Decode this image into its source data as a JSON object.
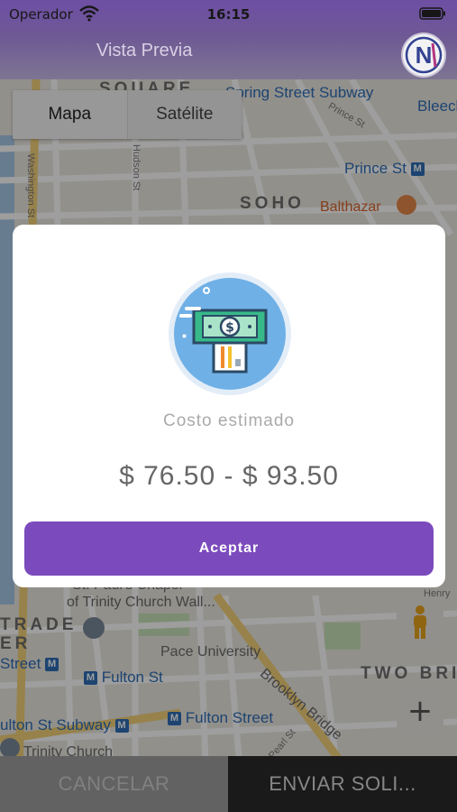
{
  "status_bar": {
    "carrier": "Operador",
    "time": "16:15",
    "wifi_icon": "wifi-icon",
    "battery_icon": "battery-icon"
  },
  "header": {
    "title": "Vista Previa",
    "logo_letter": "N",
    "background_color": "#6b4fa0"
  },
  "map_type": {
    "map_label": "Mapa",
    "satellite_label": "Satélite",
    "selected": "Mapa"
  },
  "map_labels": {
    "square": "SQUARE",
    "spring_street_subway": "Spring Street Subway",
    "prince_st_top": "Prince St",
    "bleecker": "Bleeck",
    "prince_st": "Prince St",
    "soho": "SOHO",
    "balthazar": "Balthazar",
    "washington_st": "Washington St",
    "hudson_st": "Hudson St",
    "st_pauls": "St. Paul's Chapel",
    "trinity_wall": "of Trinity Church Wall...",
    "trade": "TRADE",
    "er": "ER",
    "street": "Street",
    "pace": "Pace University",
    "fulton_st": "Fulton St",
    "fulton_subway": "ulton St Subway",
    "fulton_street": "Fulton Street",
    "two_bri": "TWO BRI",
    "brooklyn_bridge": "Brooklyn Bridge",
    "pearl_st": "Pearl St",
    "trinity_church": "Trinity Church",
    "henry": "Henry",
    "metro_symbol": "M"
  },
  "modal": {
    "cost_label": "Costo estimado",
    "cost_range": "$ 76.50 - $ 93.50",
    "accept_label": "Aceptar",
    "dollar_symbol": "$",
    "accent_color": "#7b4bbd"
  },
  "bottom_bar": {
    "cancel_label": "CANCELAR",
    "send_label": "ENVIAR SOLI..."
  },
  "map_controls": {
    "zoom_in_label": "+"
  }
}
